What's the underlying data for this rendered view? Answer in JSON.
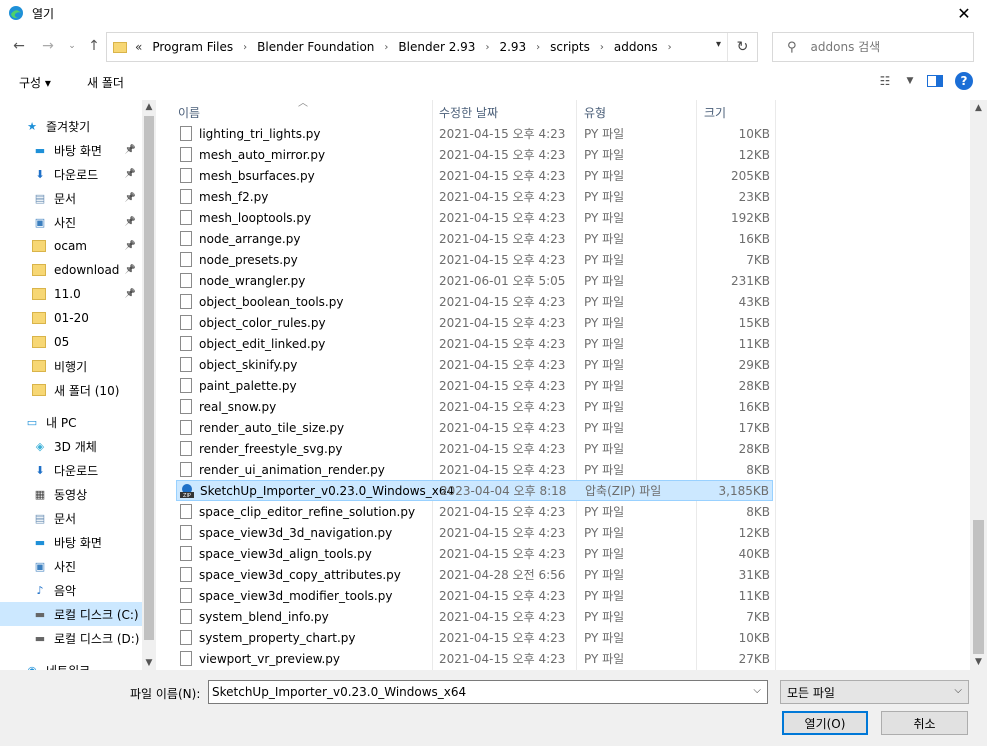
{
  "window": {
    "title": "열기"
  },
  "nav": {
    "breadcrumb_overflow": "«",
    "breadcrumbs": [
      "Program Files",
      "Blender Foundation",
      "Blender 2.93",
      "2.93",
      "scripts",
      "addons"
    ],
    "search_placeholder": "addons 검색"
  },
  "toolbar": {
    "organize_label": "구성 ▾",
    "new_folder_label": "새 폴더"
  },
  "sidebar": {
    "items": [
      {
        "label": "즐겨찾기",
        "icon": "star-icon",
        "pinned": false
      },
      {
        "label": "바탕 화면",
        "icon": "desktop-icon",
        "pinned": true
      },
      {
        "label": "다운로드",
        "icon": "download-icon",
        "pinned": true
      },
      {
        "label": "문서",
        "icon": "document-icon",
        "pinned": true
      },
      {
        "label": "사진",
        "icon": "picture-icon",
        "pinned": true
      },
      {
        "label": "ocam",
        "icon": "folder-icon",
        "pinned": true
      },
      {
        "label": "edownload",
        "icon": "folder-icon",
        "pinned": true
      },
      {
        "label": "11.0",
        "icon": "folder-icon",
        "pinned": true
      },
      {
        "label": "01-20",
        "icon": "folder-icon",
        "pinned": false
      },
      {
        "label": "05",
        "icon": "folder-icon",
        "pinned": false
      },
      {
        "label": "비행기",
        "icon": "folder-icon",
        "pinned": false
      },
      {
        "label": "새 폴더 (10)",
        "icon": "folder-icon",
        "pinned": false
      },
      {
        "label": "내 PC",
        "icon": "pc-icon",
        "pinned": false
      },
      {
        "label": "3D 개체",
        "icon": "3d-objects-icon",
        "pinned": false
      },
      {
        "label": "다운로드",
        "icon": "download-icon",
        "pinned": false
      },
      {
        "label": "동영상",
        "icon": "video-icon",
        "pinned": false
      },
      {
        "label": "문서",
        "icon": "document-icon",
        "pinned": false
      },
      {
        "label": "바탕 화면",
        "icon": "desktop-icon",
        "pinned": false
      },
      {
        "label": "사진",
        "icon": "picture-icon",
        "pinned": false
      },
      {
        "label": "음악",
        "icon": "music-icon",
        "pinned": false
      },
      {
        "label": "로컬 디스크 (C:)",
        "icon": "drive-icon",
        "pinned": false
      },
      {
        "label": "로컬 디스크 (D:)",
        "icon": "drive-icon",
        "pinned": false
      },
      {
        "label": "네트워크",
        "icon": "network-icon",
        "pinned": false
      }
    ],
    "selected_index": 20
  },
  "columns": {
    "name": "이름",
    "date": "수정한 날짜",
    "type": "유형",
    "size": "크기"
  },
  "files": [
    {
      "name": "lighting_tri_lights.py",
      "date": "2021-04-15 오후 4:23",
      "type": "PY 파일",
      "size": "10KB"
    },
    {
      "name": "mesh_auto_mirror.py",
      "date": "2021-04-15 오후 4:23",
      "type": "PY 파일",
      "size": "12KB"
    },
    {
      "name": "mesh_bsurfaces.py",
      "date": "2021-04-15 오후 4:23",
      "type": "PY 파일",
      "size": "205KB"
    },
    {
      "name": "mesh_f2.py",
      "date": "2021-04-15 오후 4:23",
      "type": "PY 파일",
      "size": "23KB"
    },
    {
      "name": "mesh_looptools.py",
      "date": "2021-04-15 오후 4:23",
      "type": "PY 파일",
      "size": "192KB"
    },
    {
      "name": "node_arrange.py",
      "date": "2021-04-15 오후 4:23",
      "type": "PY 파일",
      "size": "16KB"
    },
    {
      "name": "node_presets.py",
      "date": "2021-04-15 오후 4:23",
      "type": "PY 파일",
      "size": "7KB"
    },
    {
      "name": "node_wrangler.py",
      "date": "2021-06-01 오후 5:05",
      "type": "PY 파일",
      "size": "231KB"
    },
    {
      "name": "object_boolean_tools.py",
      "date": "2021-04-15 오후 4:23",
      "type": "PY 파일",
      "size": "43KB"
    },
    {
      "name": "object_color_rules.py",
      "date": "2021-04-15 오후 4:23",
      "type": "PY 파일",
      "size": "15KB"
    },
    {
      "name": "object_edit_linked.py",
      "date": "2021-04-15 오후 4:23",
      "type": "PY 파일",
      "size": "11KB"
    },
    {
      "name": "object_skinify.py",
      "date": "2021-04-15 오후 4:23",
      "type": "PY 파일",
      "size": "29KB"
    },
    {
      "name": "paint_palette.py",
      "date": "2021-04-15 오후 4:23",
      "type": "PY 파일",
      "size": "28KB"
    },
    {
      "name": "real_snow.py",
      "date": "2021-04-15 오후 4:23",
      "type": "PY 파일",
      "size": "16KB"
    },
    {
      "name": "render_auto_tile_size.py",
      "date": "2021-04-15 오후 4:23",
      "type": "PY 파일",
      "size": "17KB"
    },
    {
      "name": "render_freestyle_svg.py",
      "date": "2021-04-15 오후 4:23",
      "type": "PY 파일",
      "size": "28KB"
    },
    {
      "name": "render_ui_animation_render.py",
      "date": "2021-04-15 오후 4:23",
      "type": "PY 파일",
      "size": "8KB"
    },
    {
      "name": "SketchUp_Importer_v0.23.0_Windows_x64",
      "date": "2023-04-04 오후 8:18",
      "type": "압축(ZIP) 파일",
      "size": "3,185KB",
      "selected": true
    },
    {
      "name": "space_clip_editor_refine_solution.py",
      "date": "2021-04-15 오후 4:23",
      "type": "PY 파일",
      "size": "8KB"
    },
    {
      "name": "space_view3d_3d_navigation.py",
      "date": "2021-04-15 오후 4:23",
      "type": "PY 파일",
      "size": "12KB"
    },
    {
      "name": "space_view3d_align_tools.py",
      "date": "2021-04-15 오후 4:23",
      "type": "PY 파일",
      "size": "40KB"
    },
    {
      "name": "space_view3d_copy_attributes.py",
      "date": "2021-04-28 오전 6:56",
      "type": "PY 파일",
      "size": "31KB"
    },
    {
      "name": "space_view3d_modifier_tools.py",
      "date": "2021-04-15 오후 4:23",
      "type": "PY 파일",
      "size": "11KB"
    },
    {
      "name": "system_blend_info.py",
      "date": "2021-04-15 오후 4:23",
      "type": "PY 파일",
      "size": "7KB"
    },
    {
      "name": "system_property_chart.py",
      "date": "2021-04-15 오후 4:23",
      "type": "PY 파일",
      "size": "10KB"
    },
    {
      "name": "viewport_vr_preview.py",
      "date": "2021-04-15 오후 4:23",
      "type": "PY 파일",
      "size": "27KB"
    }
  ],
  "footer": {
    "filename_label": "파일 이름(N):",
    "filename_value": "SketchUp_Importer_v0.23.0_Windows_x64",
    "filetype_value": "모든 파일",
    "open_label": "열기(O)",
    "cancel_label": "취소"
  },
  "colors": {
    "accent": "#0078d7",
    "selection": "#cce8ff",
    "selection_border": "#99d1ff",
    "help": "#1b6ed6"
  }
}
